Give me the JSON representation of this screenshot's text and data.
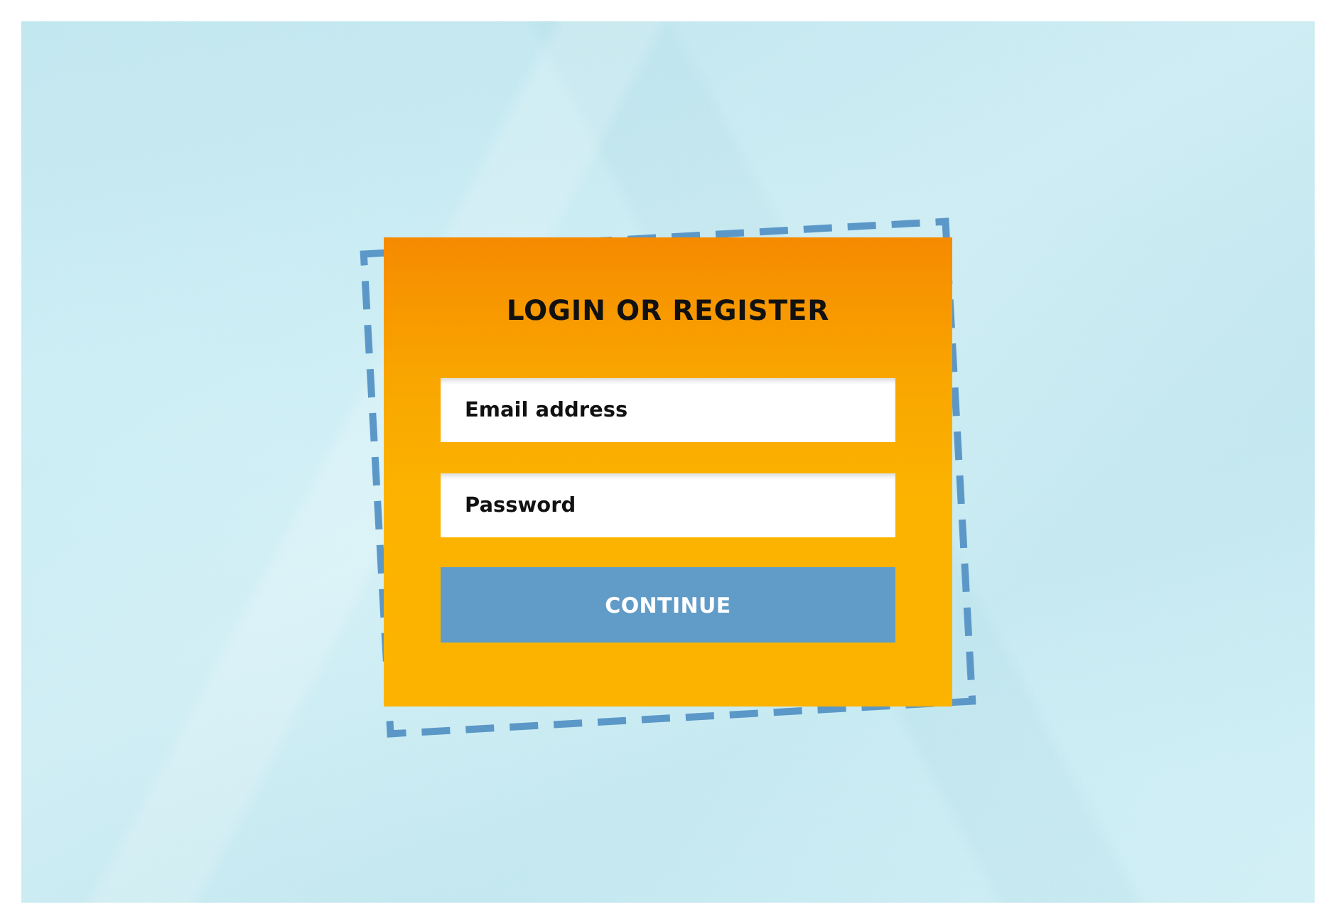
{
  "form": {
    "title": "LOGIN OR REGISTER",
    "fields": [
      {
        "placeholder": "Email address"
      },
      {
        "placeholder": "Password"
      }
    ],
    "button": "CONTINUE"
  }
}
